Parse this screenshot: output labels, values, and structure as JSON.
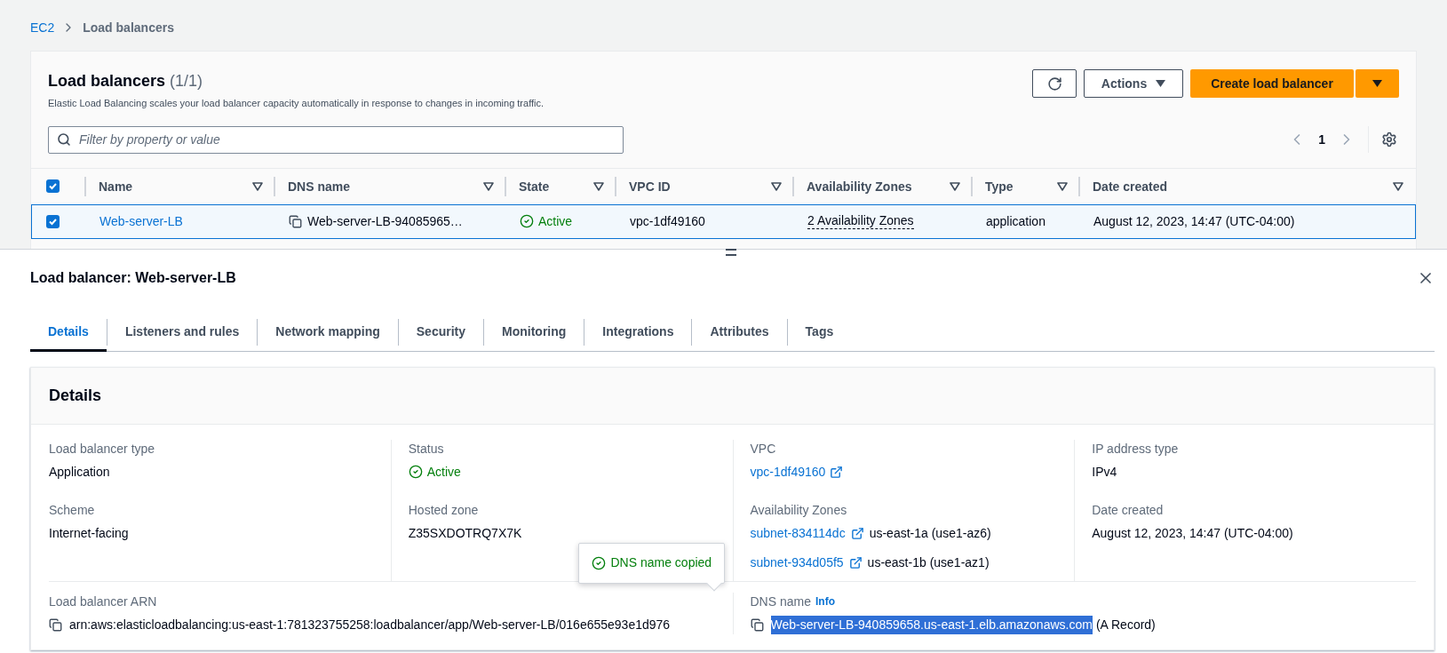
{
  "breadcrumb": [
    {
      "label": "EC2",
      "kind": "link"
    },
    {
      "label": "Load balancers",
      "kind": "current"
    }
  ],
  "list": {
    "title": "Load balancers",
    "count": "(1/1)",
    "description": "Elastic Load Balancing scales your load balancer capacity automatically in response to changes in incoming traffic.",
    "actions_label": "Actions",
    "create_label": "Create load balancer",
    "filter": {
      "placeholder": "Filter by property or value"
    },
    "page": "1"
  },
  "table": {
    "all_checked": true,
    "columns": [
      "Name",
      "DNS name",
      "State",
      "VPC ID",
      "Availability Zones",
      "Type",
      "Date created"
    ],
    "rows": [
      {
        "selected": true,
        "name": "Web-server-LB",
        "dns_name": "Web-server-LB-94085965…",
        "state": "Active",
        "vpc_id": "vpc-1df49160",
        "availability_zones": "2 Availability Zones",
        "type": "application",
        "date_created": "August 12, 2023, 14:47 (UTC-04:00)"
      }
    ]
  },
  "detail": {
    "title": "Load balancer: Web-server-LB",
    "tabs": [
      {
        "label": "Details",
        "selected": true
      },
      {
        "label": "Listeners and rules",
        "selected": false
      },
      {
        "label": "Network mapping",
        "selected": false
      },
      {
        "label": "Security",
        "selected": false
      },
      {
        "label": "Monitoring",
        "selected": false
      },
      {
        "label": "Integrations",
        "selected": false
      },
      {
        "label": "Attributes",
        "selected": false
      },
      {
        "label": "Tags",
        "selected": false
      }
    ],
    "section_title": "Details",
    "columns": [
      [
        {
          "kind": "text",
          "label": "Load balancer type",
          "value": "Application"
        },
        {
          "kind": "text",
          "label": "Scheme",
          "value": "Internet-facing"
        }
      ],
      [
        {
          "kind": "status",
          "label": "Status",
          "value": "Active"
        },
        {
          "kind": "text",
          "label": "Hosted zone",
          "value": "Z35SXDOTRQ7X7K"
        }
      ],
      [
        {
          "kind": "link",
          "label": "VPC",
          "value": "vpc-1df49160"
        },
        {
          "kind": "zones",
          "label": "Availability Zones",
          "subnets": [
            {
              "id": "subnet-834114dc",
              "zone": "us-east-1a (use1-az6)"
            },
            {
              "id": "subnet-934d05f5",
              "zone": "us-east-1b (use1-az1)"
            }
          ]
        }
      ],
      [
        {
          "kind": "text",
          "label": "IP address type",
          "value": "IPv4"
        },
        {
          "kind": "text",
          "label": "Date created",
          "value": "August 12, 2023, 14:47 (UTC-04:00)"
        }
      ]
    ],
    "arn": {
      "label": "Load balancer ARN",
      "value": "arn:aws:elasticloadbalancing:us-east-1:781323755258:loadbalancer/app/Web-server-LB/016e655e93e1d976"
    },
    "dns": {
      "label": "DNS name",
      "info": "Info",
      "value": "Web-server-LB-940859658.us-east-1.elb.amazonaws.com",
      "selected": true,
      "suffix": "(A Record)"
    },
    "tooltip": {
      "text": "DNS name copied"
    }
  }
}
